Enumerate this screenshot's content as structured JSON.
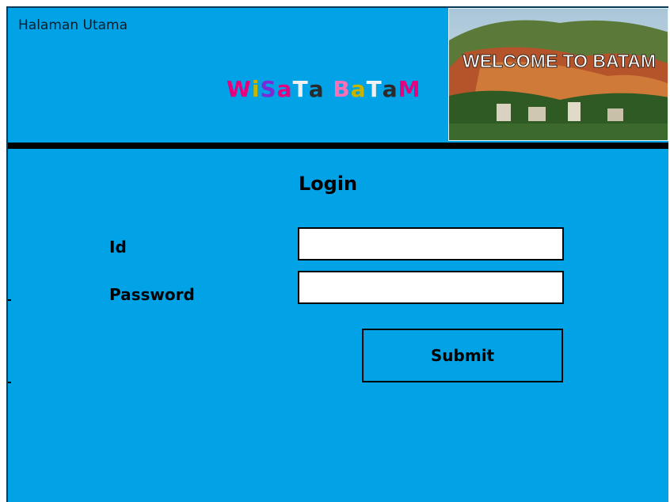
{
  "header": {
    "home_link": "Halaman Utama",
    "brand_letters": [
      {
        "char": "W",
        "color": "#e6007e"
      },
      {
        "char": "i",
        "color": "#c8b400"
      },
      {
        "char": "S",
        "color": "#7a2bd6"
      },
      {
        "char": "a",
        "color": "#e6007e"
      },
      {
        "char": "T",
        "color": "#f0f0f0"
      },
      {
        "char": "a",
        "color": "#2a2a2a"
      },
      {
        "char": " ",
        "color": "#000000"
      },
      {
        "char": "B",
        "color": "#ff6fb8"
      },
      {
        "char": "a",
        "color": "#c8b400"
      },
      {
        "char": "T",
        "color": "#f0f0f0"
      },
      {
        "char": "a",
        "color": "#2a2a2a"
      },
      {
        "char": "M",
        "color": "#e6007e"
      }
    ],
    "banner_text": "WELCOME TO BATAM"
  },
  "login": {
    "title": "Login",
    "id_label": "Id",
    "password_label": "Password",
    "id_value": "",
    "password_value": "",
    "submit_label": "Submit"
  },
  "colors": {
    "background": "#02a2e6",
    "divider": "#000000",
    "input_bg": "#ffffff"
  }
}
